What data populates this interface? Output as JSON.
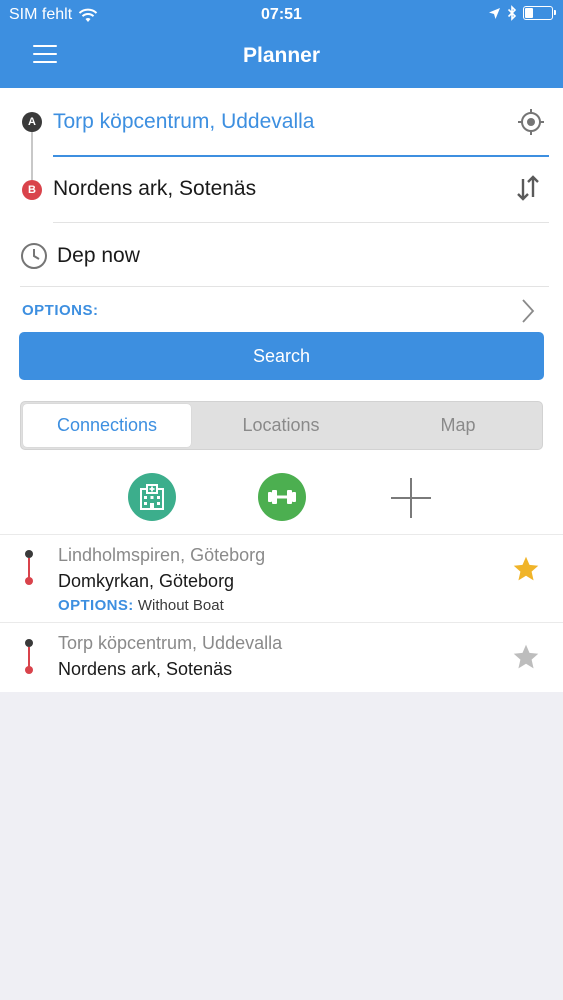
{
  "status_bar": {
    "carrier": "SIM fehlt",
    "time": "07:51",
    "battery_level": 0.3
  },
  "header": {
    "title": "Planner",
    "color": "#3d8fe0"
  },
  "route": {
    "from_marker": "A",
    "to_marker": "B",
    "from_value": "Torp köpcentrum, Uddevalla",
    "to_value": "Nordens ark, Sotenäs",
    "departure": "Dep now"
  },
  "options_label": "OPTIONS:",
  "search_label": "Search",
  "tabs": [
    {
      "label": "Connections",
      "active": true
    },
    {
      "label": "Locations",
      "active": false
    },
    {
      "label": "Map",
      "active": false
    }
  ],
  "favorites": [
    {
      "icon": "hospital-icon",
      "color": "#3cae8c"
    },
    {
      "icon": "dumbbell-icon",
      "color": "#4caf50"
    }
  ],
  "saved_connections": [
    {
      "from": "Torp köpcentrum, Uddevalla",
      "to": "Nordens ark, Sotenäs",
      "favorite": false
    }
  ],
  "options_prefix": "OPTIONS:",
  "first_connection": {
    "from": "Lindholmspiren, Göteborg",
    "to": "Domkyrkan, Göteborg",
    "options_value": "Without Boat",
    "favorite": true
  },
  "colors": {
    "accent": "#3d8fe0",
    "destination": "#d9434b",
    "star_active": "#f0b429",
    "star_inactive": "#bdbdbd"
  }
}
